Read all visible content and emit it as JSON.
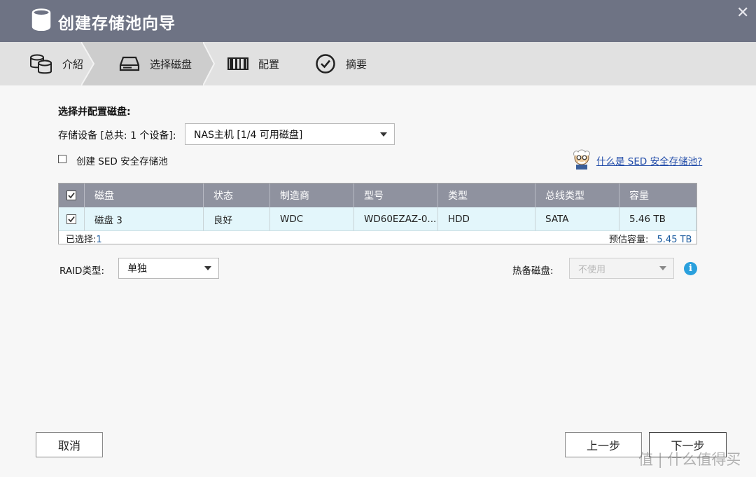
{
  "window": {
    "title": "创建存储池向导",
    "icon": "database-icon",
    "close_icon": "close-icon"
  },
  "steps": [
    {
      "label": "介紹",
      "icon": "storage-pool-icon",
      "active": false
    },
    {
      "label": "选择磁盘",
      "icon": "disk-drive-icon",
      "active": true
    },
    {
      "label": "配置",
      "icon": "config-icon",
      "active": false
    },
    {
      "label": "摘要",
      "icon": "checkmark-circle-icon",
      "active": false
    }
  ],
  "form": {
    "section_title": "选择并配置磁盘:",
    "device_label": "存储设备 [总共: 1 个设备]:",
    "device_value": "NAS主机 [1/4 可用磁盘]",
    "sed_label": "创建 SED 安全存储池",
    "sed_checked": false,
    "sed_help_link": "什么是 SED 安全存储池?"
  },
  "table": {
    "columns": [
      "磁盘",
      "状态",
      "制造商",
      "型号",
      "类型",
      "总线类型",
      "容量"
    ],
    "rows": [
      {
        "checked": true,
        "disk": "磁盘 3",
        "status": "良好",
        "vendor": "WDC",
        "model": "WD60EZAZ-0...",
        "type": "HDD",
        "bus": "SATA",
        "capacity": "5.46 TB"
      }
    ],
    "selected_label": "已选择:",
    "selected_count": "1",
    "estimated_label": "预估容量:",
    "estimated_value": "5.45 TB"
  },
  "raid": {
    "label": "RAID类型:",
    "value": "单独"
  },
  "spare": {
    "label": "热备磁盘:",
    "value": "不使用",
    "info_icon": "info-icon"
  },
  "buttons": {
    "cancel": "取消",
    "back": "上一步",
    "next": "下一步"
  },
  "watermark": "值 | 什么值得买",
  "colors": {
    "titlebar": "#6e7384",
    "table_header": "#8f929f",
    "selected_row": "#e3f6fb",
    "link": "#1f4aa8",
    "info": "#2aa0dd"
  }
}
